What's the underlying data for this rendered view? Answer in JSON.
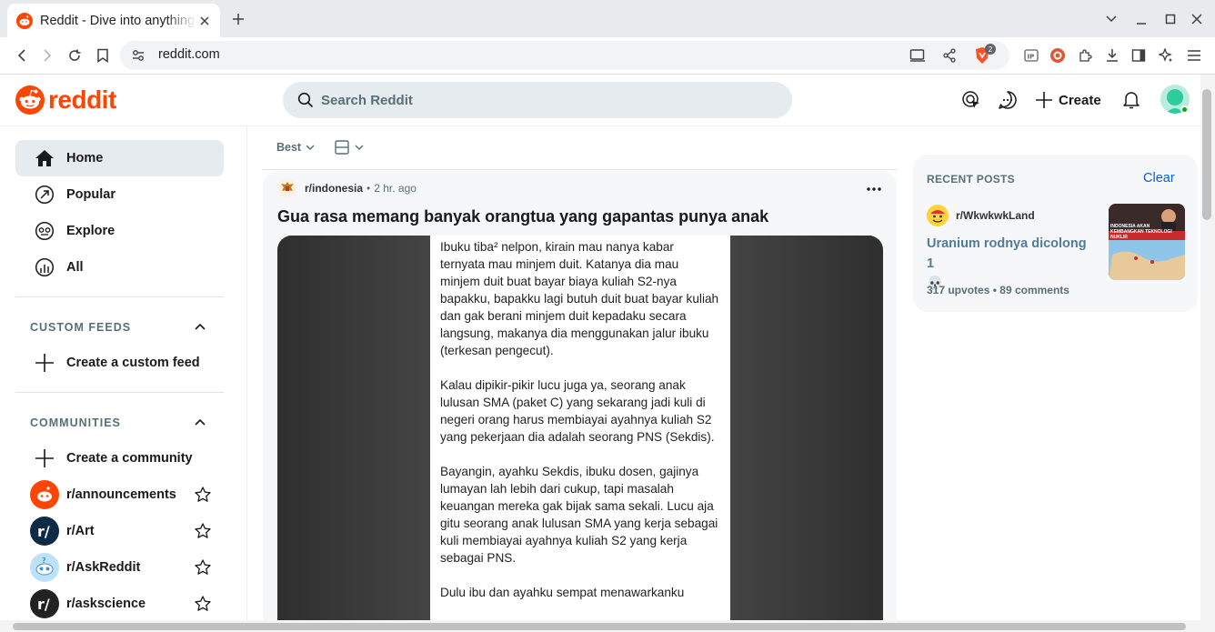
{
  "browser": {
    "tab_title": "Reddit - Dive into anything",
    "url": "reddit.com",
    "shields_count": "2"
  },
  "header": {
    "logo_text": "reddit",
    "search_placeholder": "Search Reddit",
    "create_label": "Create"
  },
  "sidebar": {
    "nav": [
      {
        "label": "Home",
        "icon": "home-icon"
      },
      {
        "label": "Popular",
        "icon": "popular-icon"
      },
      {
        "label": "Explore",
        "icon": "explore-icon"
      },
      {
        "label": "All",
        "icon": "all-icon"
      }
    ],
    "custom_feeds_header": "CUSTOM FEEDS",
    "create_feed_label": "Create a custom feed",
    "communities_header": "COMMUNITIES",
    "create_community_label": "Create a community",
    "communities": [
      {
        "name": "r/announcements",
        "color": "#ff4500"
      },
      {
        "name": "r/Art",
        "color": "#0e2a47"
      },
      {
        "name": "r/AskReddit",
        "color": "#bde0fb"
      },
      {
        "name": "r/askscience",
        "color": "#222222"
      }
    ]
  },
  "feed": {
    "sort_label": "Best",
    "post": {
      "subreddit": "r/indonesia",
      "age": "2 hr. ago",
      "title": "Gua rasa memang banyak orangtua yang gapantas punya anak",
      "paragraphs": [
        "Ibuku tiba² nelpon, kirain mau nanya kabar ternyata mau minjem duit. Katanya dia mau minjem duit buat bayar biaya kuliah S2-nya bapakku, bapakku lagi butuh duit buat bayar kuliah dan gak berani minjem duit kepadaku secara langsung, makanya dia menggunakan jalur ibuku (terkesan pengecut).",
        "Kalau dipikir-pikir lucu juga ya, seorang anak lulusan SMA (paket C) yang sekarang jadi kuli di negeri orang harus membiayai ayahnya kuliah S2 yang pekerjaan dia adalah seorang PNS (Sekdis).",
        "Bayangin, ayahku Sekdis, ibuku dosen, gajinya lumayan lah lebih dari cukup, tapi masalah keuangan mereka gak bijak sama sekali. Lucu aja gitu seorang anak lulusan SMA yang kerja sebagai kuli membiayai ayahnya kuliah S2 yang kerja sebagai PNS.",
        "Dulu ibu dan ayahku sempat menawarkanku"
      ]
    }
  },
  "recent": {
    "header": "RECENT POSTS",
    "clear_label": "Clear",
    "item": {
      "subreddit": "r/WkwkwkLand",
      "title": "Uranium rodnya dicolong 1",
      "title_emoji": "💀",
      "upvotes": "317 upvotes",
      "comments": "89 comments",
      "thumb_caption": "INDONESIA AKAN KEMBANGKAN TEKNOLOGI NUKLIR"
    }
  },
  "colors": {
    "brand": "#ff4500",
    "link": "#0a5ed7",
    "muted": "#576f76"
  }
}
